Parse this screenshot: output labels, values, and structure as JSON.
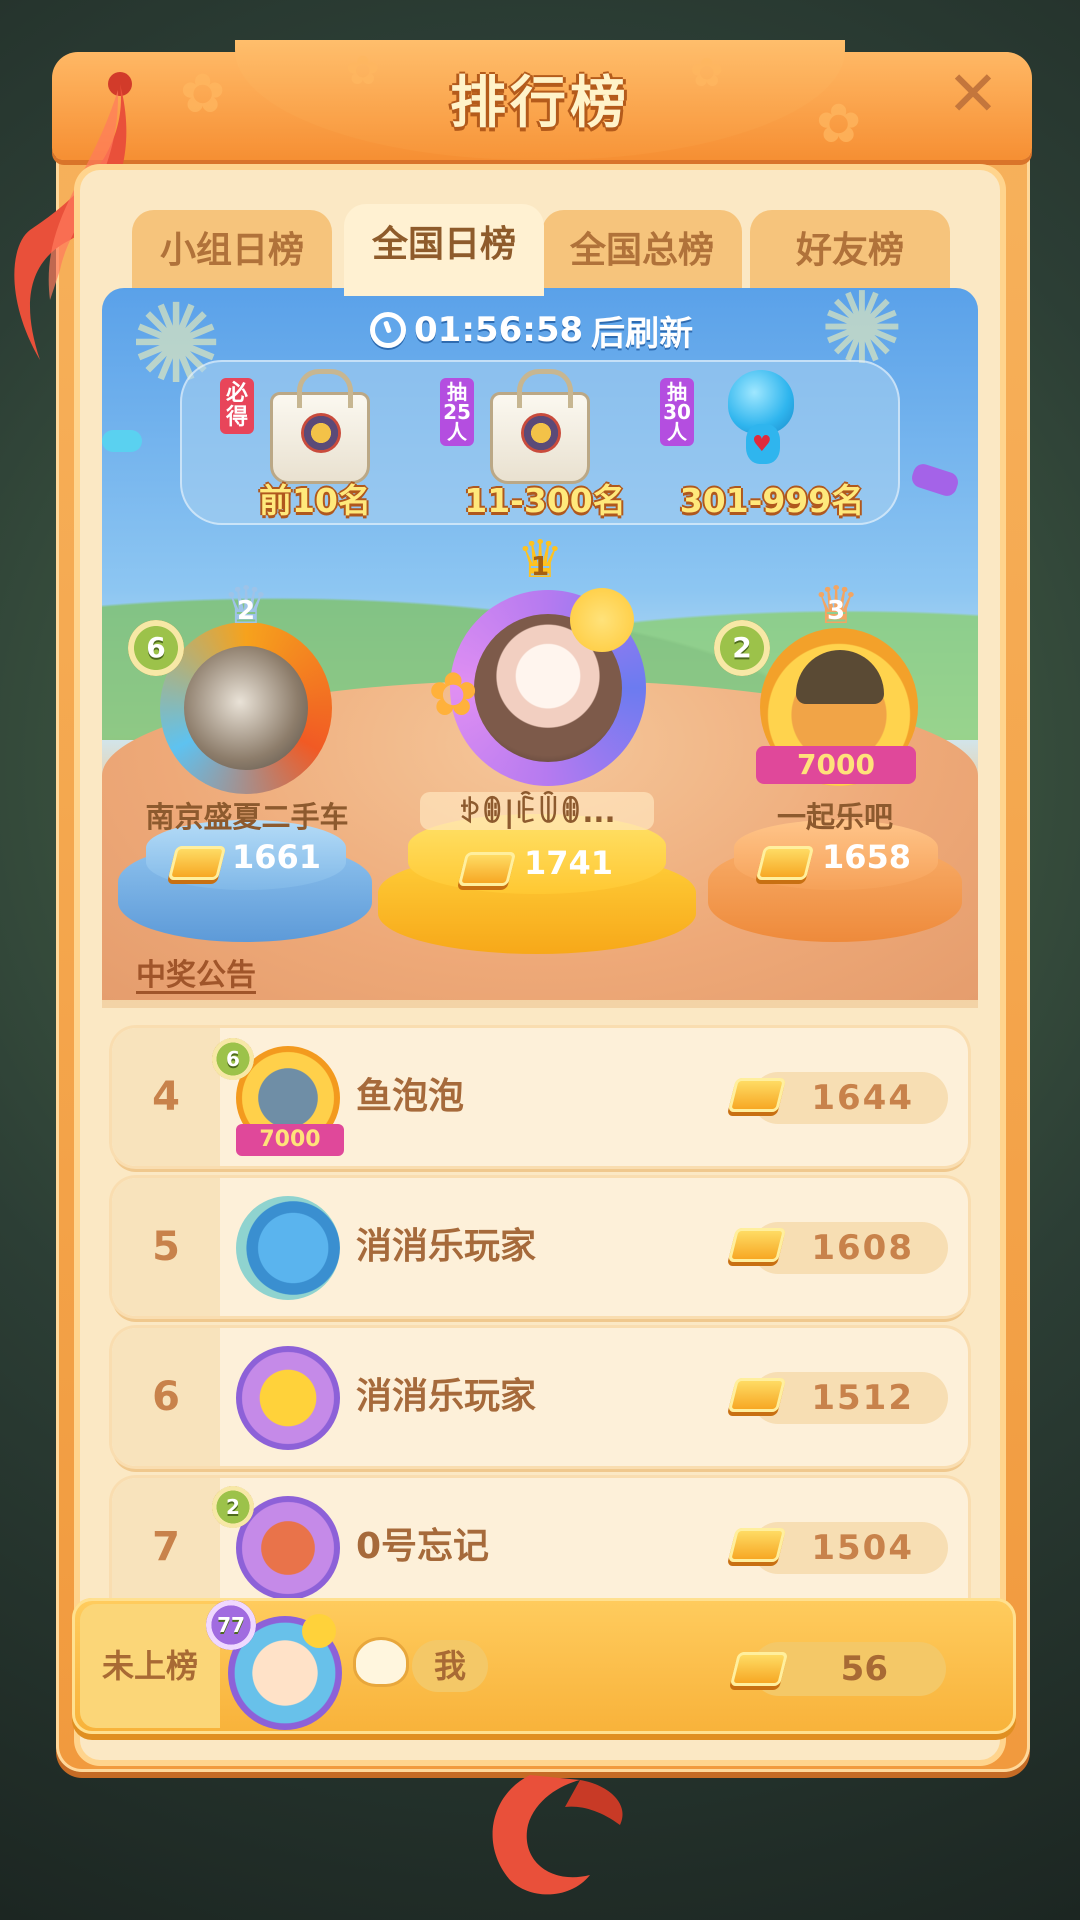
{
  "header": {
    "title": "排行榜",
    "close_icon": "close-icon"
  },
  "tabs": [
    {
      "label": "小组日榜",
      "active": false
    },
    {
      "label": "全国日榜",
      "active": true
    },
    {
      "label": "全国总榜",
      "active": false
    },
    {
      "label": "好友榜",
      "active": false
    }
  ],
  "timer": {
    "time": "01:56:58",
    "suffix": "后刷新"
  },
  "rewards": [
    {
      "badge": "必得",
      "label": "前10名",
      "item": "bag-icon"
    },
    {
      "badge": "抽25人",
      "label": "11-300名",
      "item": "bag-icon"
    },
    {
      "badge": "抽30人",
      "label": "301-999名",
      "item": "blue-bear-toy-icon"
    }
  ],
  "podium": {
    "first": {
      "rank": "1",
      "name": "ꉣꂦ|ꍟꅏꂦ...",
      "score": "1741"
    },
    "second": {
      "rank": "2",
      "name": "南京盛夏二手车",
      "score": "1661",
      "level": "6"
    },
    "third": {
      "rank": "3",
      "name": "一起乐吧",
      "score": "1658",
      "level": "2",
      "frame_tag": "7000"
    }
  },
  "announcement": "中奖公告",
  "list": [
    {
      "rank": "4",
      "name": "鱼泡泡",
      "score": "1644",
      "level": "6",
      "frame_tag": "7000"
    },
    {
      "rank": "5",
      "name": "消消乐玩家",
      "score": "1608"
    },
    {
      "rank": "6",
      "name": "消消乐玩家",
      "score": "1512"
    },
    {
      "rank": "7",
      "name": "0号忘记",
      "score": "1504",
      "level": "2"
    }
  ],
  "me": {
    "rank": "未上榜",
    "name": "我",
    "score": "56",
    "level": "77"
  },
  "colors": {
    "accent": "#f19a3e",
    "panel": "#fbe8c4",
    "gold": "#f6a21d"
  }
}
